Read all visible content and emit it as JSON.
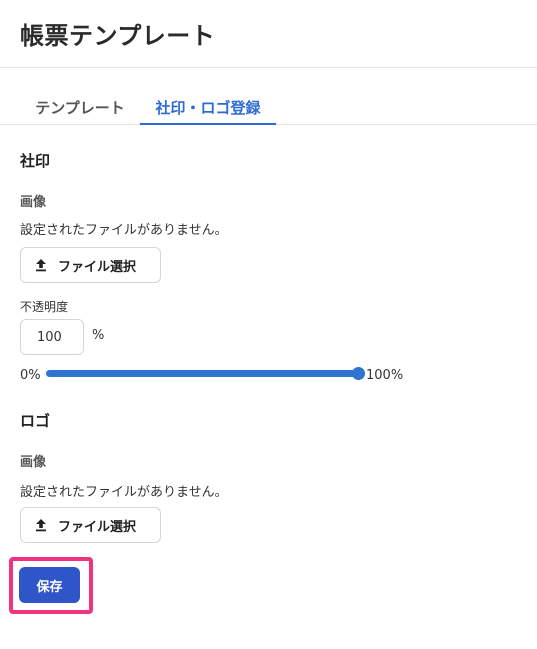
{
  "header": {
    "title": "帳票テンプレート"
  },
  "tabs": [
    {
      "label": "テンプレート",
      "active": false
    },
    {
      "label": "社印・ロゴ登録",
      "active": true
    }
  ],
  "seal": {
    "section_title": "社印",
    "image_label": "画像",
    "no_file_text": "設定されたファイルがありません。",
    "file_button_label": "ファイル選択",
    "file_button_icon": "upload-icon",
    "opacity_label": "不透明度",
    "opacity_value": "100",
    "opacity_unit": "%",
    "slider": {
      "min_label": "0%",
      "max_label": "100%",
      "value_percent": 100
    }
  },
  "logo": {
    "section_title": "ロゴ",
    "image_label": "画像",
    "no_file_text": "設定されたファイルがありません。",
    "file_button_label": "ファイル選択",
    "file_button_icon": "upload-icon"
  },
  "actions": {
    "save_label": "保存"
  },
  "colors": {
    "accent": "#2f6bd3",
    "save_button": "#2f56c8",
    "highlight": "#f0337f"
  }
}
